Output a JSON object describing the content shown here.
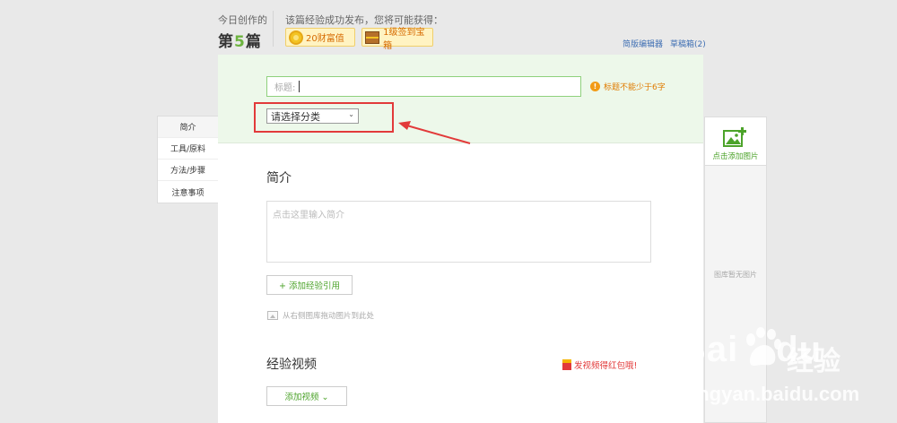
{
  "header": {
    "today_label": "今日创作的",
    "today_count_prefix": "第",
    "today_count_num": "5",
    "today_count_suffix": "篇",
    "reward_label": "该篇经验成功发布，您将可能获得：",
    "badges": [
      {
        "icon": "coin-icon",
        "label": "20财富值"
      },
      {
        "icon": "chest-icon",
        "label": "1级签到宝箱"
      }
    ],
    "simple_editor_link": "简版编辑器",
    "drafts_link": "草稿箱(2)"
  },
  "title_zone": {
    "title_placeholder": "标题:",
    "title_warning": "标题不能少于6字",
    "category_select_value": "请选择分类",
    "colors": {
      "highlight": "#e23a3a",
      "zone_bg": "#edf8ea",
      "input_border": "#8fd17c"
    }
  },
  "side_nav": {
    "items": [
      "简介",
      "工具/原料",
      "方法/步骤",
      "注意事项"
    ]
  },
  "intro": {
    "title": "简介",
    "textarea_placeholder": "点击这里输入简介",
    "add_ref_label": "+ 添加经验引用",
    "drag_hint": "从右侧图库拖动图片到此处"
  },
  "video": {
    "title": "经验视频",
    "promo": "发视频得红包哦!",
    "add_video_label": "添加视频 ⌄"
  },
  "image_panel": {
    "add_image_label": "点击添加图片",
    "empty_label": "图库暂无图片"
  },
  "watermark": {
    "logo": "Bai",
    "logo_suffix": "du",
    "brand": "经验",
    "url": "jingyan.baidu.com"
  }
}
